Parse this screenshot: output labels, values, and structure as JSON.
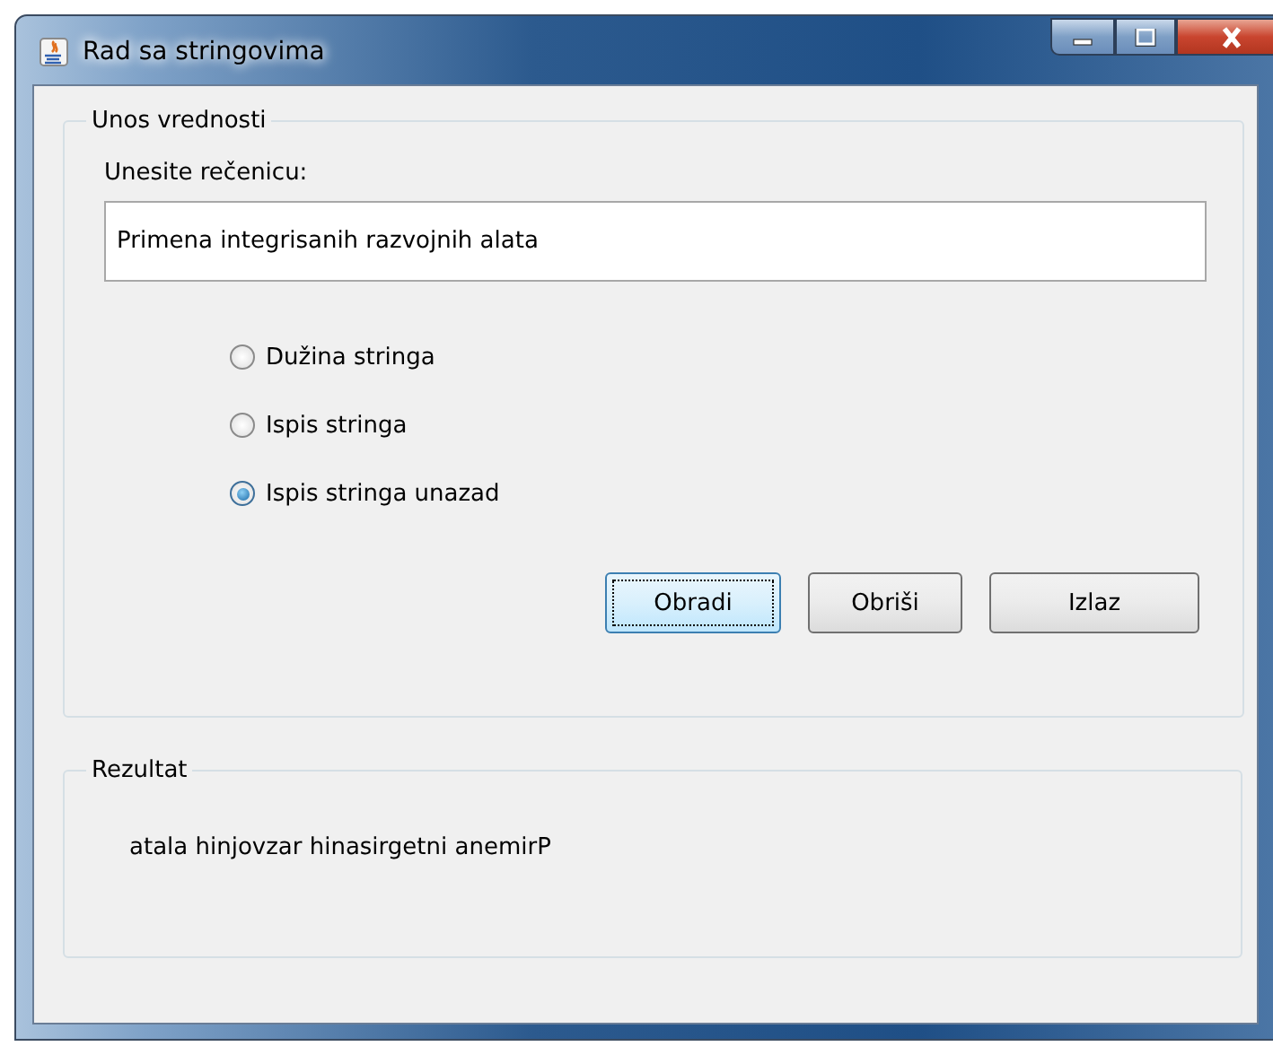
{
  "window": {
    "title": "Rad sa stringovima"
  },
  "input_group": {
    "title": "Unos vrednosti",
    "label": "Unesite rečenicu:",
    "field": {
      "value": "Primena integrisanih razvojnih alata"
    },
    "options": [
      {
        "label": "Dužina stringa",
        "selected": false
      },
      {
        "label": "Ispis stringa",
        "selected": false
      },
      {
        "label": "Ispis stringa unazad",
        "selected": true
      }
    ],
    "buttons": [
      {
        "label": "Obradi",
        "focused": true
      },
      {
        "label": "Obriši",
        "focused": false
      },
      {
        "label": "Izlaz",
        "focused": false
      }
    ]
  },
  "result_group": {
    "title": "Rezultat",
    "text": "atala hinjovzar hinasirgetni anemirP"
  }
}
